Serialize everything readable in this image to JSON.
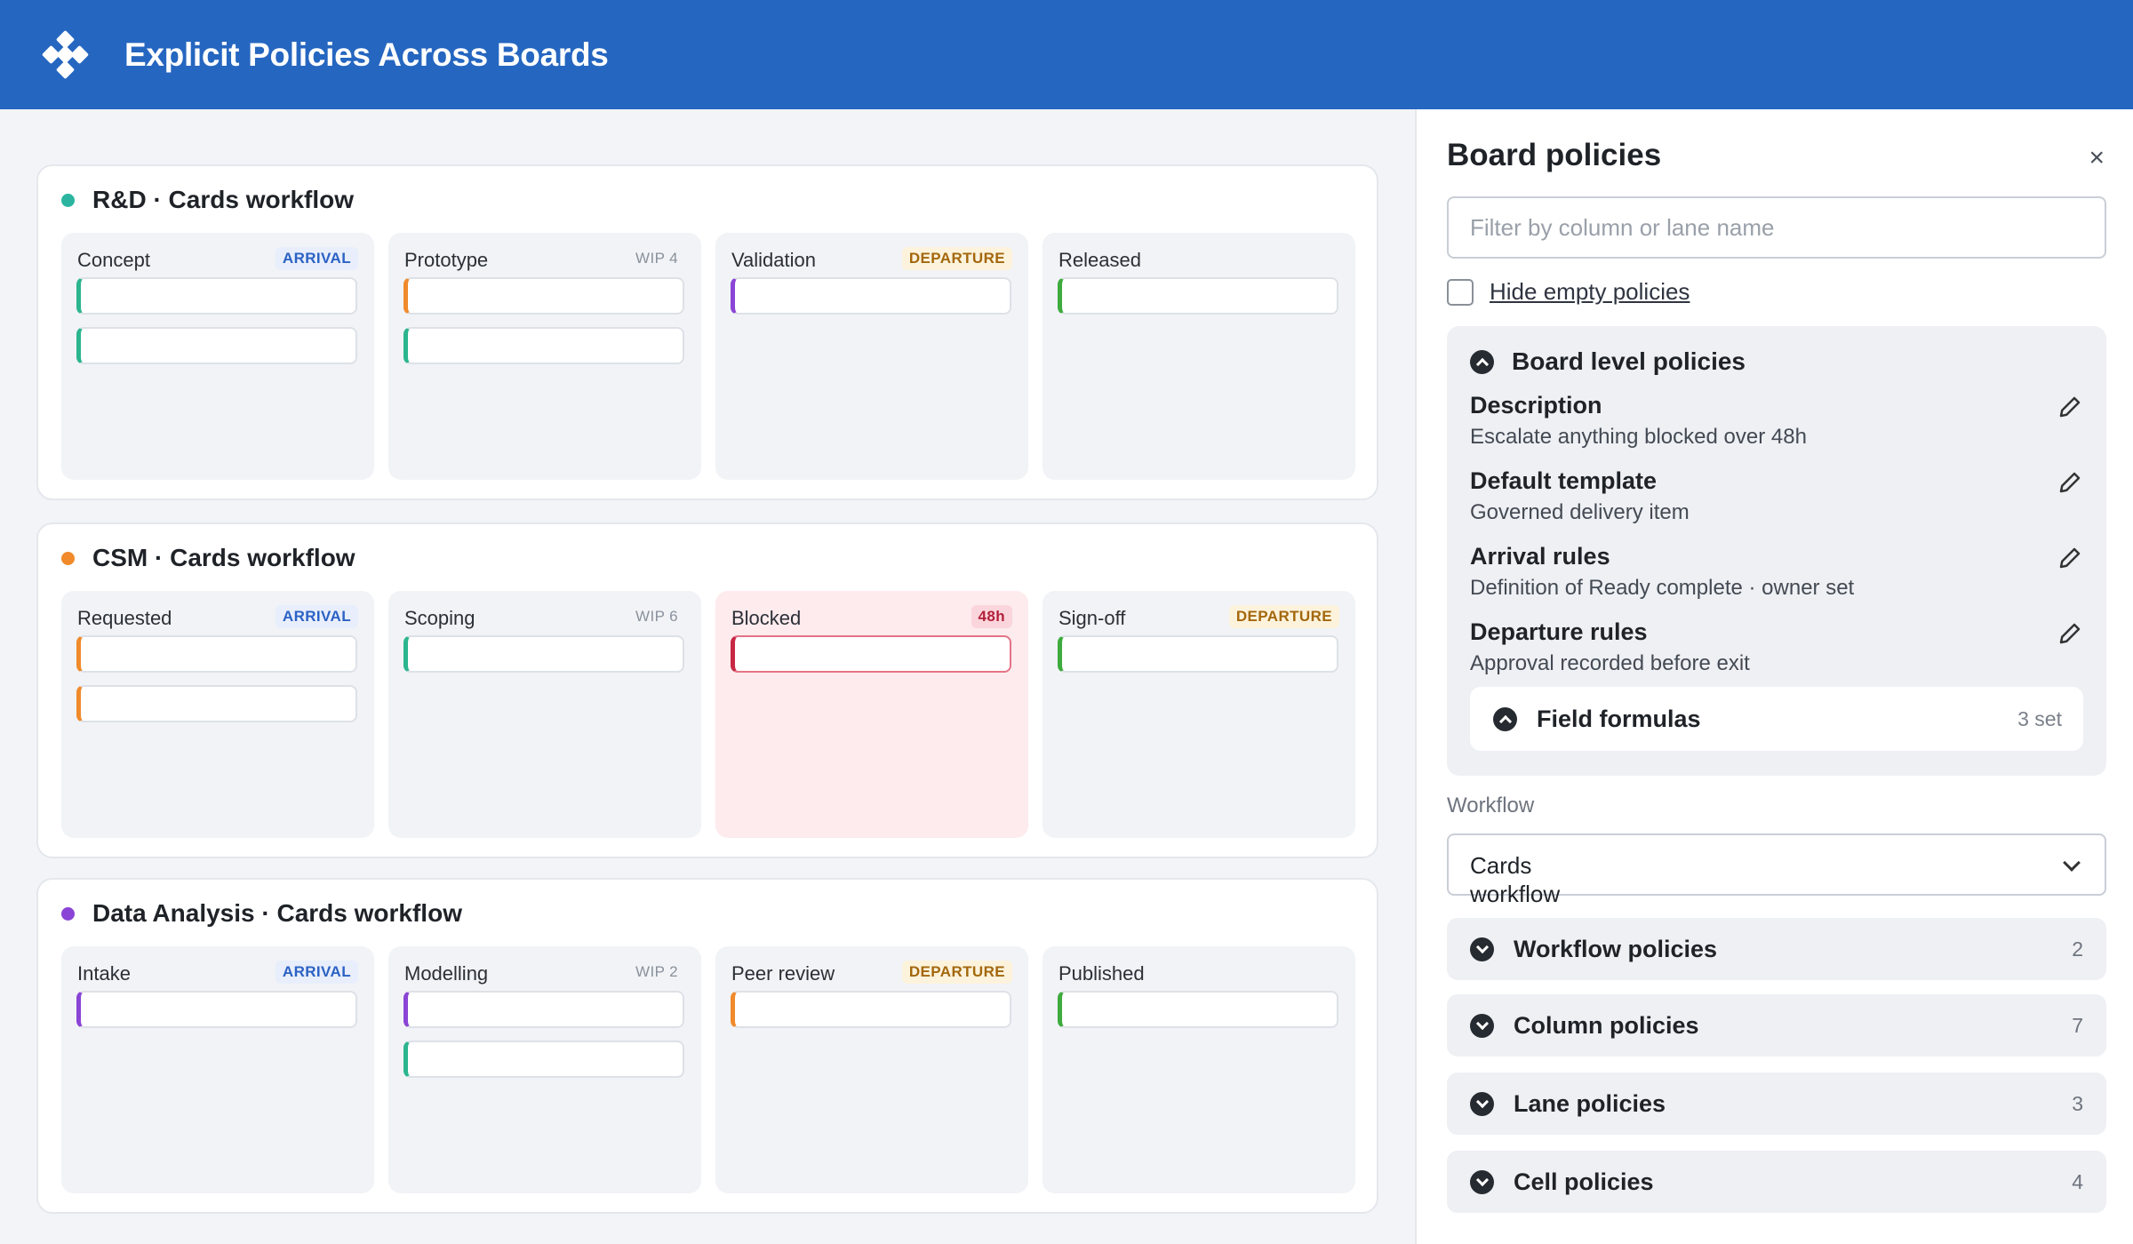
{
  "app": {
    "title": "Explicit Policies Across Boards"
  },
  "boards": [
    {
      "title": "R&D · Cards workflow",
      "dot_color": "#2bb5a0",
      "columns": [
        {
          "name": "Concept",
          "badge": "ARRIVAL",
          "badge_type": "arrival",
          "cards": [
            "#2bb58f",
            "#2bb58f"
          ]
        },
        {
          "name": "Prototype",
          "badge": "WIP 4",
          "badge_type": "wip",
          "cards": [
            "#f08a2b",
            "#2bb58f"
          ]
        },
        {
          "name": "Validation",
          "badge": "DEPARTURE",
          "badge_type": "departure",
          "cards": [
            "#8a44d6"
          ]
        },
        {
          "name": "Released",
          "badge": "",
          "badge_type": "",
          "cards": [
            "#3dab3d"
          ]
        }
      ]
    },
    {
      "title": "CSM · Cards workflow",
      "dot_color": "#f08a2b",
      "columns": [
        {
          "name": "Requested",
          "badge": "ARRIVAL",
          "badge_type": "arrival",
          "cards": [
            "#f08a2b",
            "#f08a2b"
          ]
        },
        {
          "name": "Scoping",
          "badge": "WIP 6",
          "badge_type": "wip",
          "cards": [
            "#2bb58f"
          ]
        },
        {
          "name": "Blocked",
          "badge": "48h",
          "badge_type": "time",
          "blocked": true,
          "cards": [
            "#c82846"
          ]
        },
        {
          "name": "Sign-off",
          "badge": "DEPARTURE",
          "badge_type": "departure",
          "cards": [
            "#3dab3d"
          ]
        }
      ]
    },
    {
      "title": "Data Analysis · Cards workflow",
      "dot_color": "#8a44d6",
      "columns": [
        {
          "name": "Intake",
          "badge": "ARRIVAL",
          "badge_type": "arrival",
          "cards": [
            "#8a44d6"
          ]
        },
        {
          "name": "Modelling",
          "badge": "WIP 2",
          "badge_type": "wip",
          "cards": [
            "#8a44d6",
            "#2bb58f"
          ]
        },
        {
          "name": "Peer review",
          "badge": "DEPARTURE",
          "badge_type": "departure",
          "cards": [
            "#f08a2b"
          ]
        },
        {
          "name": "Published",
          "badge": "",
          "badge_type": "",
          "cards": [
            "#3dab3d"
          ]
        }
      ]
    }
  ],
  "panel": {
    "title": "Board policies",
    "close_icon": "×",
    "filter_placeholder": "Filter by column or lane name",
    "hide_empty_label": "Hide empty policies",
    "board_level": {
      "title": "Board level policies",
      "items": [
        {
          "title": "Description",
          "value": "Escalate anything blocked over 48h"
        },
        {
          "title": "Default template",
          "value": "Governed delivery item"
        },
        {
          "title": "Arrival rules",
          "value": "Definition of Ready complete · owner set"
        },
        {
          "title": "Departure rules",
          "value": "Approval recorded before exit"
        }
      ],
      "formulas": {
        "title": "Field formulas",
        "count": "3 set"
      }
    },
    "workflow_label": "Workflow",
    "workflow_value": "Cards workflow",
    "sections": [
      {
        "title": "Workflow policies",
        "count": "2"
      },
      {
        "title": "Column policies",
        "count": "7"
      },
      {
        "title": "Lane policies",
        "count": "3"
      },
      {
        "title": "Cell policies",
        "count": "4"
      }
    ]
  },
  "colors": {
    "header": "#2566c0",
    "accent_blue": "#2b62c4",
    "departure": "#a3670d",
    "blocked": "#c82846"
  }
}
